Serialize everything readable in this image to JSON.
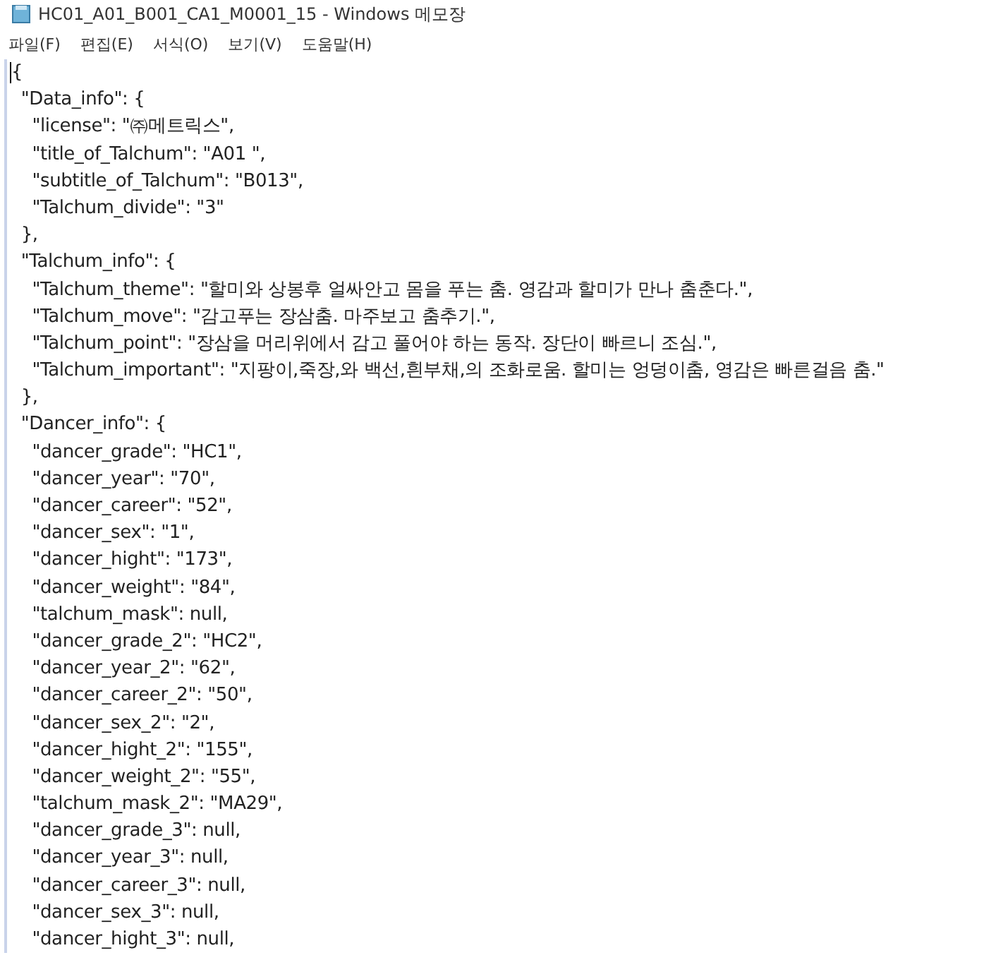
{
  "window": {
    "title": "HC01_A01_B001_CA1_M0001_15 - Windows 메모장"
  },
  "menu": [
    "파일(F)",
    "편집(E)",
    "서식(O)",
    "보기(V)",
    "도움말(H)"
  ],
  "document": {
    "lines": [
      "{",
      "  \"Data_info\": {",
      "    \"license\": \"㈜메트릭스\",",
      "    \"title_of_Talchum\": \"A01 \",",
      "    \"subtitle_of_Talchum\": \"B013\",",
      "    \"Talchum_divide\": \"3\"",
      "  },",
      "  \"Talchum_info\": {",
      "    \"Talchum_theme\": \"할미와 상봉후 얼싸안고 몸을 푸는 춤. 영감과 할미가 만나 춤춘다.\",",
      "    \"Talchum_move\": \"감고푸는 장삼춤. 마주보고 춤추기.\",",
      "    \"Talchum_point\": \"장삼을 머리위에서 감고 풀어야 하는 동작. 장단이 빠르니 조심.\",",
      "    \"Talchum_important\": \"지팡이,죽장,와 백선,흰부채,의 조화로움. 할미는 엉덩이춤, 영감은 빠른걸음 춤.\"",
      "  },",
      "  \"Dancer_info\": {",
      "    \"dancer_grade\": \"HC1\",",
      "    \"dancer_year\": \"70\",",
      "    \"dancer_career\": \"52\",",
      "    \"dancer_sex\": \"1\",",
      "    \"dancer_hight\": \"173\",",
      "    \"dancer_weight\": \"84\",",
      "    \"talchum_mask\": null,",
      "    \"dancer_grade_2\": \"HC2\",",
      "    \"dancer_year_2\": \"62\",",
      "    \"dancer_career_2\": \"50\",",
      "    \"dancer_sex_2\": \"2\",",
      "    \"dancer_hight_2\": \"155\",",
      "    \"dancer_weight_2\": \"55\",",
      "    \"talchum_mask_2\": \"MA29\",",
      "    \"dancer_grade_3\": null,",
      "    \"dancer_year_3\": null,",
      "    \"dancer_career_3\": null,",
      "    \"dancer_sex_3\": null,",
      "    \"dancer_hight_3\": null,"
    ]
  }
}
